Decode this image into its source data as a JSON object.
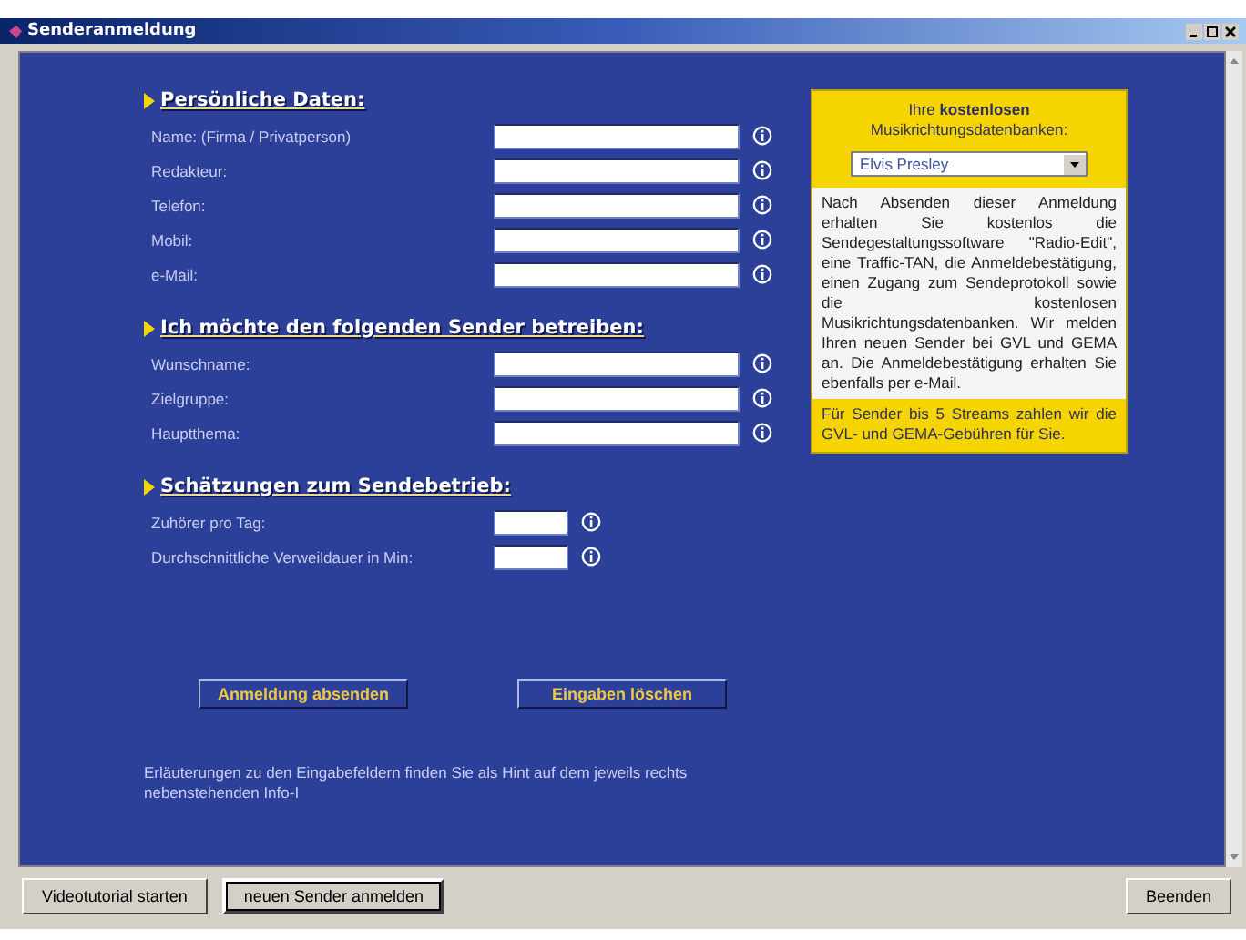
{
  "window": {
    "title": "Senderanmeldung"
  },
  "sections": [
    {
      "heading": "Persönliche Daten:",
      "fields": [
        {
          "label": "Name: (Firma / Privatperson)",
          "kind": "wide"
        },
        {
          "label": "Redakteur:",
          "kind": "wide"
        },
        {
          "label": "Telefon:",
          "kind": "wide"
        },
        {
          "label": "Mobil:",
          "kind": "wide"
        },
        {
          "label": "e-Mail:",
          "kind": "wide"
        }
      ]
    },
    {
      "heading": "Ich möchte den folgenden Sender betreiben:",
      "fields": [
        {
          "label": "Wunschname:",
          "kind": "wide"
        },
        {
          "label": "Zielgruppe:",
          "kind": "wide"
        },
        {
          "label": "Hauptthema:",
          "kind": "wide"
        }
      ]
    },
    {
      "heading": "Schätzungen zum Sendebetrieb:",
      "fields": [
        {
          "label": "Zuhörer pro Tag:",
          "kind": "short"
        },
        {
          "label": "Durchschnittliche Verweildauer in Min:",
          "kind": "short"
        }
      ]
    }
  ],
  "form_buttons": [
    "Anmeldung absenden",
    "Eingaben löschen"
  ],
  "hint": "Erläuterungen zu den Eingabefeldern finden Sie als Hint auf dem jeweils rechts nebenstehenden Info-I",
  "info_panel": {
    "title": "Ihre **kostenlosen** Musikrichtungsdatenbanken:",
    "dropdown": "Elvis Presley",
    "text": "Nach Absenden dieser Anmeldung erhalten Sie kostenlos die Sendegestaltungssoftware \"Radio-Edit\", eine Traffic-TAN, die Anmeldebestätigung, einen Zugang zum Sendeprotokoll sowie die kostenlosen Musikrichtungsdatenbanken. Wir melden Ihren neuen Sender bei GVL und GEMA an. Die Anmeldebestätigung erhalten Sie ebenfalls per e-Mail.",
    "footer": "Für Sender bis 5 Streams zahlen wir die GVL- und GEMA-Gebühren für Sie."
  },
  "bottom_buttons": [
    {
      "label": "Videotutorial starten",
      "focused": false
    },
    {
      "label": "neuen Sender anmelden",
      "focused": true
    }
  ],
  "exit_button": {
    "label": "Beenden",
    "focused": false
  }
}
